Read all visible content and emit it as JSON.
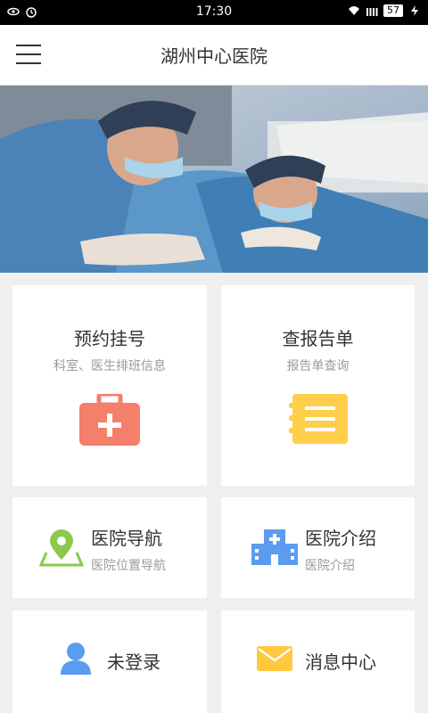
{
  "status_bar": {
    "time": "17:30",
    "battery": "57"
  },
  "header": {
    "title": "湖州中心医院"
  },
  "cards": {
    "appointment": {
      "title": "预约挂号",
      "subtitle": "科室、医生排班信息"
    },
    "report": {
      "title": "查报告单",
      "subtitle": "报告单查询"
    },
    "navigation": {
      "title": "医院导航",
      "subtitle": "医院位置导航"
    },
    "intro": {
      "title": "医院介绍",
      "subtitle": "医院介绍"
    },
    "login": {
      "title": "未登录"
    },
    "messages": {
      "title": "消息中心"
    }
  },
  "icons": {
    "appointment": "medical-kit-icon",
    "report": "report-document-icon",
    "navigation": "map-pin-icon",
    "intro": "hospital-building-icon",
    "login": "user-icon",
    "messages": "mail-icon"
  },
  "colors": {
    "kit": "#f47f6b",
    "report": "#ffce4a",
    "map": "#8cc84b",
    "hospital": "#5b9cf0",
    "user": "#5b9cf0",
    "mail": "#ffc83d"
  }
}
